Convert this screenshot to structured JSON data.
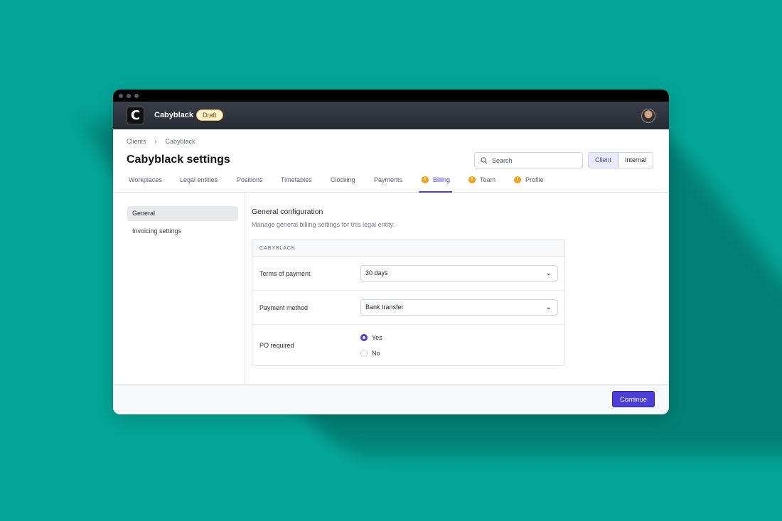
{
  "app": {
    "name": "Cabyblack",
    "status_badge": "Draft",
    "logo_letter": "C"
  },
  "breadcrumb": [
    "Clients",
    "Cabyblack"
  ],
  "page_title": "Cabyblack settings",
  "search": {
    "placeholder": "Search"
  },
  "view_toggle": {
    "options": [
      "Client",
      "Internal"
    ],
    "selected": "Client"
  },
  "tabs": [
    {
      "label": "Workplaces",
      "warning": false
    },
    {
      "label": "Legal entities",
      "warning": false
    },
    {
      "label": "Positions",
      "warning": false
    },
    {
      "label": "Timetables",
      "warning": false
    },
    {
      "label": "Clocking",
      "warning": false
    },
    {
      "label": "Payments",
      "warning": false
    },
    {
      "label": "Billing",
      "warning": true,
      "active": true
    },
    {
      "label": "Team",
      "warning": true
    },
    {
      "label": "Profile",
      "warning": true
    }
  ],
  "sidebar": {
    "items": [
      {
        "label": "General",
        "selected": true
      },
      {
        "label": "Invoicing settings",
        "selected": false
      }
    ]
  },
  "section": {
    "title": "General configuration",
    "description": "Manage general billing settings for this legal entity."
  },
  "card": {
    "header": "CABYBLACK",
    "terms_label": "Terms of payment",
    "terms_value": "30 days",
    "method_label": "Payment method",
    "method_value": "Bank transfer",
    "po_label": "PO required",
    "po_options": [
      "Yes",
      "No"
    ],
    "po_selected": "Yes"
  },
  "footer": {
    "continue_label": "Continue"
  },
  "colors": {
    "accent": "#4b3fd8",
    "background": "#04a597",
    "warning": "#f0a31a"
  }
}
